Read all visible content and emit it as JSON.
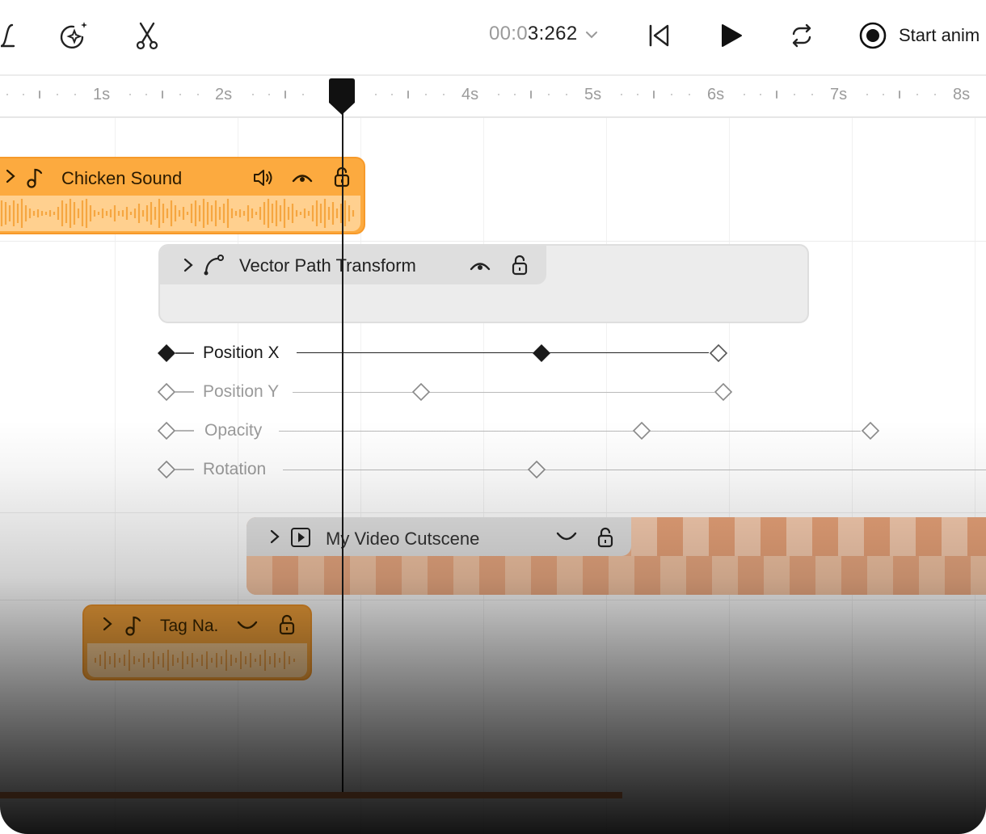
{
  "toolbar": {
    "timecode_dim": "00:0",
    "timecode_main": "3:262",
    "start_label": "Start anim",
    "icons": [
      "curve-icon",
      "magic-icon",
      "scissors-icon",
      "skip-back-icon",
      "play-icon",
      "loop-icon",
      "record-icon",
      "chevron-down-icon"
    ]
  },
  "ruler": {
    "labels": [
      "1s",
      "2s",
      "4s",
      "5s",
      "6s",
      "7s",
      "8s"
    ]
  },
  "tracks": {
    "audio": {
      "name": "Chicken Sound",
      "color": "#fcaa3f"
    },
    "vector": {
      "name": "Vector Path Transform"
    },
    "properties": [
      {
        "name": "Position X",
        "active": true
      },
      {
        "name": "Position Y",
        "active": false
      },
      {
        "name": "Opacity",
        "active": false
      },
      {
        "name": "Rotation",
        "active": false
      }
    ],
    "video": {
      "name": "My Video Cutscene"
    },
    "tag": {
      "name": "Tag Na."
    }
  },
  "colors": {
    "accent": "#fcaa3f",
    "video": "#f2b48c",
    "playhead": "#1a1a1a"
  }
}
